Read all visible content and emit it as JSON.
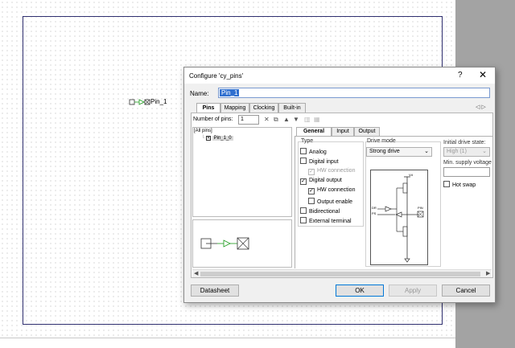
{
  "canvas": {
    "symbol_label": "Pin_1"
  },
  "dialog": {
    "title": "Configure 'cy_pins'",
    "help_label": "?",
    "close_label": "✕",
    "name_label": "Name:",
    "name_value": "Pin_1",
    "tabs": [
      "Pins",
      "Mapping",
      "Clocking",
      "Built-in"
    ],
    "tab_scroll_arrows": "◁ ▷",
    "toolbar": {
      "num_pins_label": "Number of pins:",
      "num_pins_value": "1"
    },
    "tree": {
      "root": "[All pins]",
      "pin": "Pin_1_0"
    },
    "subtabs": [
      "General",
      "Input",
      "Output"
    ],
    "general": {
      "type_label": "Type",
      "type_options": [
        {
          "label": "Analog",
          "checked": false,
          "disabled": false
        },
        {
          "label": "Digital input",
          "checked": false,
          "disabled": false
        },
        {
          "label": "HW connection",
          "checked": true,
          "disabled": true
        },
        {
          "label": "Digital output",
          "checked": true,
          "disabled": false
        },
        {
          "label": "HW connection",
          "checked": true,
          "disabled": false
        },
        {
          "label": "Output enable",
          "checked": false,
          "disabled": false
        },
        {
          "label": "Bidirectional",
          "checked": false,
          "disabled": false
        },
        {
          "label": "External terminal",
          "checked": false,
          "disabled": false
        }
      ],
      "drive_mode_label": "Drive mode",
      "drive_mode_value": "Strong drive",
      "initial_drive_state_label": "Initial drive state:",
      "initial_drive_state_value": "High (1)",
      "min_supply_label": "Min. supply voltage",
      "min_supply_value": "",
      "hot_swap_label": "Hot swap",
      "diagram_labels": {
        "vdd": "Vd",
        "dr": "DR",
        "ps": "PS",
        "pin": "PIN"
      }
    },
    "buttons": {
      "datasheet": "Datasheet",
      "ok": "OK",
      "apply": "Apply",
      "cancel": "Cancel"
    }
  }
}
